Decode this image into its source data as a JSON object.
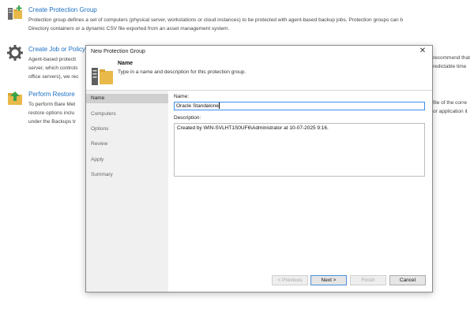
{
  "background": {
    "items": [
      {
        "title": "Create Protection Group",
        "lines": [
          "Protection group defines a set of computers (physical server, workstations or cloud instances) to be protected with agent-based backup jobs. Protection groups can b",
          "Directory containers or a dynamic CSV file exported from an asset management system."
        ],
        "icon": "protection-group-icon"
      },
      {
        "title": "Create Job or Policy",
        "lines": [
          "Agent-based protecti",
          "server, which controls",
          "office servers), we rec"
        ],
        "right_lines": [
          "recommend that",
          "redictable time",
          ""
        ],
        "icon": "gear-icon"
      },
      {
        "title": "Perform Restore",
        "lines": [
          "To perform Bare Met",
          "restore options inclu",
          "under the Backups tr"
        ],
        "right_lines": [
          "file of the corre",
          "or application it",
          ""
        ],
        "icon": "restore-icon"
      }
    ]
  },
  "dialog": {
    "title": "New Protection Group",
    "header": {
      "title": "Name",
      "subtitle": "Type in a name and description for this protection group."
    },
    "steps": [
      "Name",
      "Computers",
      "Options",
      "Review",
      "Apply",
      "Summary"
    ],
    "active_step": 0,
    "name_label": "Name:",
    "name_value": "Oracle Standalone",
    "description_label": "Description:",
    "description_value": "Created by WIN-SVLHT1S0UF6\\Administrator at 10-07-2025 9:16.",
    "buttons": {
      "previous": "< Previous",
      "next": "Next >",
      "finish": "Finish",
      "cancel": "Cancel"
    }
  },
  "colors": {
    "link_blue": "#1b6fc2",
    "focus_border": "#3c8ee8",
    "sidebar_bg": "#f0f0f0",
    "active_step_bg": "#cfcfcf"
  }
}
